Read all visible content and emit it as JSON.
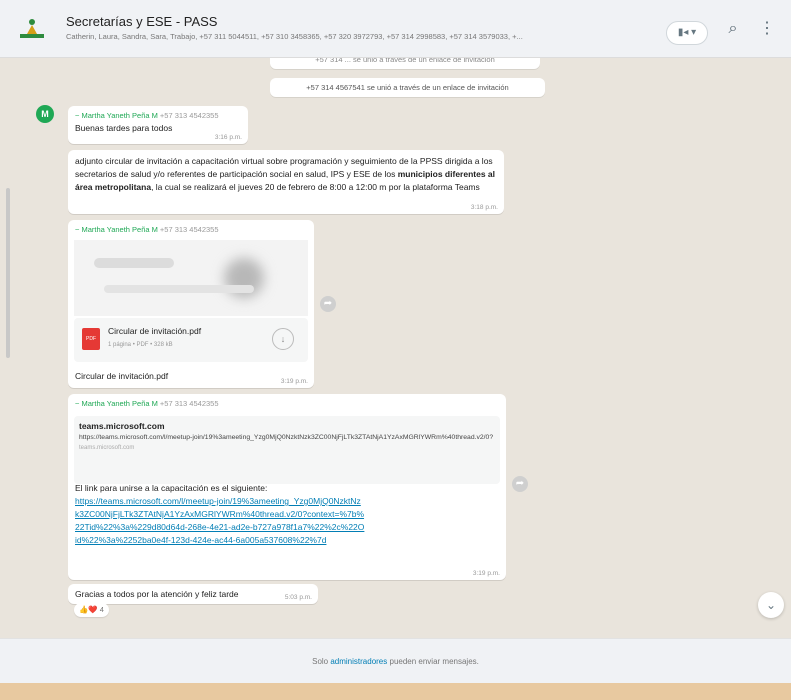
{
  "header": {
    "title": "Secretarías y ESE - PASS",
    "subtitle": "Catherin, Laura, Sandra, Sara, Trabajo, +57 311 5044511, +57 310 3458365, +57 320 3972793, +57 314 2998583, +57 314 3579033, +...",
    "video_label": "▮◂ ▾",
    "search_glyph": "⌕",
    "menu_glyph": "⋮"
  },
  "chat": {
    "sys_top": "+57 314 ... se unió a través de un enlace de invitación",
    "sys_joined": "+57 314 4567541 se unió a través de un enlace de invitación",
    "avatar_letter": "M",
    "msg1": {
      "sender": "~ Martha Yaneth Peña M",
      "number": "+57 313 4542355",
      "text": "Buenas tardes para todos",
      "time": "3:16 p.m."
    },
    "msg2": {
      "text_a": "adjunto circular de invitación a capacitación virtual sobre programación y seguimiento de la PPSS dirigida a los secretarios de salud y/o referentes de participación social en salud, IPS y ESE de los ",
      "text_bold": "municipios diferentes al área metropolitana",
      "text_b": ", la cual se realizará el jueves 20 de febrero de 8:00 a 12:00 m por la plataforma Teams",
      "time": "3:18 p.m."
    },
    "msg3": {
      "sender": "~ Martha Yaneth Peña M",
      "number": "+57 313 4542355",
      "file_name": "Circular de invitación.pdf",
      "file_meta": "1 página • PDF • 328 kB",
      "file_icon": "PDF",
      "caption": "Circular de invitación.pdf",
      "time": "3:19 p.m."
    },
    "msg4": {
      "sender": "~ Martha Yaneth Peña M",
      "number": "+57 313 4542355",
      "preview_title": "teams.microsoft.com",
      "preview_url": "https://teams.microsoft.com/l/meetup-join/19%3ameeting_Yzg0MjQ0NzktNzk3ZC00NjFjLTk3ZTAtNjA1YzAxMGRlYWRm%40thread.v2/0?",
      "preview_domain": "teams.microsoft.com",
      "text": "El link para unirse a la capacitación es el siguiente:",
      "link": "https://teams.microsoft.com/l/meetup-join/19%3ameeting_Yzg0MjQ0NzktNzk3ZC00NjFjLTk3ZTAtNjA1YzAxMGRlYWRm%40thread.v2/0?context=%7b%22Tid%22%3a%229d80d64d-268e-4e21-ad2e-b727a978f1a7%22%2c%22Oid%22%3a%2252ba0e4f-123d-424e-ac44-6a005a537608%22%7d",
      "time": "3:19 p.m."
    },
    "msg5": {
      "text": "Gracias a todos por la atención y feliz tarde",
      "time": "5:03 p.m.",
      "reactions": "👍❤️",
      "reaction_count": "4"
    }
  },
  "footer": {
    "text_a": "Solo ",
    "text_admin": "administradores",
    "text_b": " pueden enviar mensajes."
  },
  "scroll_down_glyph": "⌄"
}
